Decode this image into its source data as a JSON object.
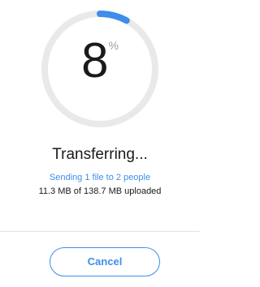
{
  "progress": {
    "percent_value": "8",
    "percent_sign": "%",
    "fraction": 0.08,
    "track_color": "#e9e9e9",
    "fill_color": "#3d8eea"
  },
  "status": {
    "title": "Transferring...",
    "detail": "Sending 1 file to 2 people",
    "bytes": "11.3 MB of 138.7 MB uploaded"
  },
  "actions": {
    "cancel_label": "Cancel"
  },
  "colors": {
    "accent": "#3d8eea",
    "text": "#1a1a1a",
    "muted": "#9e9e9e"
  }
}
